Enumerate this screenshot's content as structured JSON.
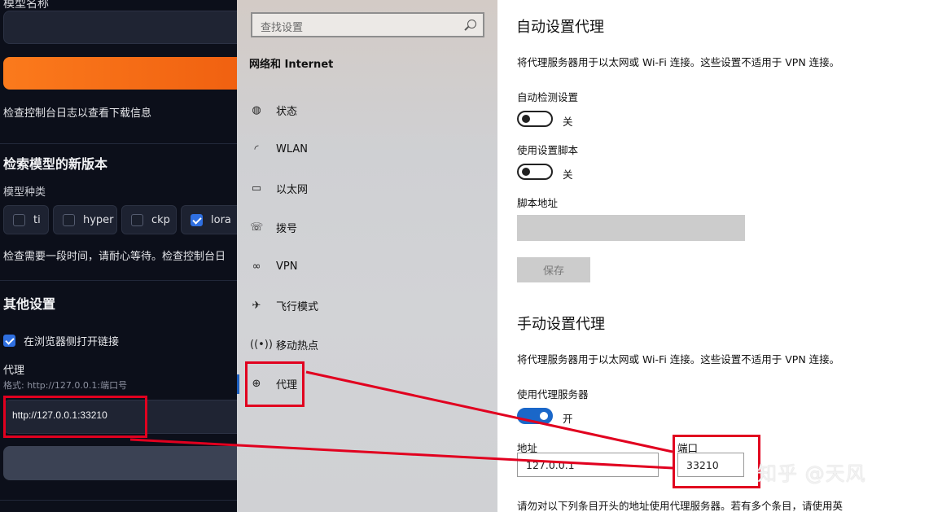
{
  "left_panel": {
    "top_label": "模型名称",
    "info_text": "检查控制台日志以查看下载信息",
    "check_new_heading": "检索模型的新版本",
    "model_type_label": "模型种类",
    "model_types": [
      {
        "label": "ti",
        "checked": false
      },
      {
        "label": "hyper",
        "checked": false
      },
      {
        "label": "ckp",
        "checked": false
      },
      {
        "label": "lora",
        "checked": true
      }
    ],
    "wait_text": "检查需要一段时间，请耐心等待。检查控制台日",
    "other_heading": "其他设置",
    "open_in_browser_label": "在浏览器侧打开链接",
    "open_in_browser_checked": true,
    "proxy_label": "代理",
    "proxy_hint": "格式: http://127.0.0.1:端口号",
    "proxy_value": "http://127.0.0.1:33210",
    "colors": {
      "background": "#0c0f1a",
      "orange": "#f57018",
      "check": "#2f6fe0"
    }
  },
  "nav": {
    "search_placeholder": "查找设置",
    "section_title": "网络和 Internet",
    "items": [
      {
        "label": "状态",
        "icon": "globe-status-icon"
      },
      {
        "label": "WLAN",
        "icon": "wifi-icon"
      },
      {
        "label": "以太网",
        "icon": "ethernet-icon"
      },
      {
        "label": "拨号",
        "icon": "dialup-icon"
      },
      {
        "label": "VPN",
        "icon": "vpn-icon"
      },
      {
        "label": "飞行模式",
        "icon": "airplane-icon"
      },
      {
        "label": "移动热点",
        "icon": "hotspot-icon"
      },
      {
        "label": "代理",
        "icon": "globe-icon"
      }
    ],
    "active_item": "代理"
  },
  "settings": {
    "auto_heading": "自动设置代理",
    "auto_desc": "将代理服务器用于以太网或 Wi-Fi 连接。这些设置不适用于 VPN 连接。",
    "auto_detect_label": "自动检测设置",
    "auto_detect_state": "关",
    "use_script_label": "使用设置脚本",
    "use_script_state": "关",
    "script_address_label": "脚本地址",
    "save_label": "保存",
    "manual_heading": "手动设置代理",
    "manual_desc": "将代理服务器用于以太网或 Wi-Fi 连接。这些设置不适用于 VPN 连接。",
    "use_proxy_label": "使用代理服务器",
    "use_proxy_state": "开",
    "address_label": "地址",
    "address_value": "127.0.0.1",
    "port_label": "端口",
    "port_value": "33210",
    "bottom_text": "请勿对以下列条目开头的地址使用代理服务器。若有多个条目，请使用英",
    "toggle_on_color": "#1a67c9"
  },
  "annotation": {
    "highlight_color": "#e1001f",
    "watermark": "知乎 @天风"
  }
}
